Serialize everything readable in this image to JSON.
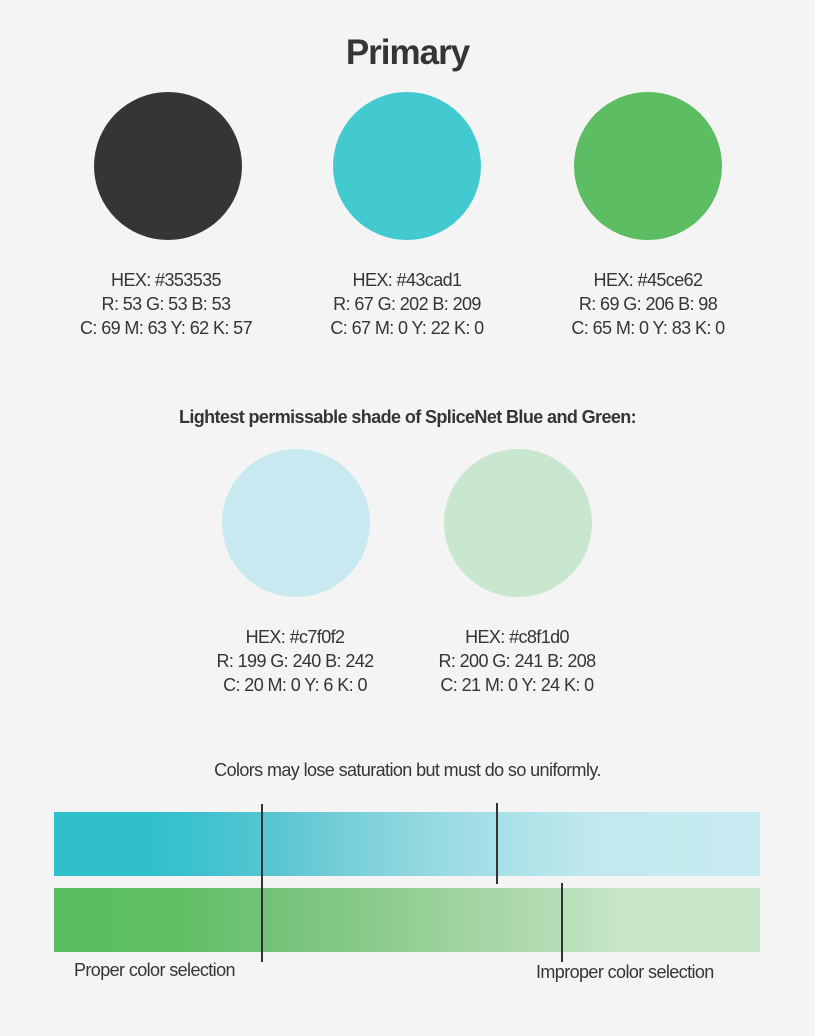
{
  "title": "Primary",
  "primary": [
    {
      "color": "#353535",
      "hex": "HEX: #353535",
      "rgb": "R: 53 G: 53 B: 53",
      "cmyk": "C: 69 M: 63 Y: 62 K: 57"
    },
    {
      "color": "#43cad1",
      "hex": "HEX: #43cad1",
      "rgb": "R: 67 G: 202 B: 209",
      "cmyk": "C: 67 M: 0 Y: 22 K: 0"
    },
    {
      "color": "#5cbd62",
      "hex": "HEX: #45ce62",
      "rgb": "R: 69 G: 206 B: 98",
      "cmyk": "C: 65 M: 0 Y: 83 K: 0"
    }
  ],
  "lightest_heading": "Lightest permissable shade of SpliceNet Blue and Green:",
  "lightest": [
    {
      "color": "#c9e9f0",
      "hex": "HEX: #c7f0f2",
      "rgb": "R: 199 G: 240 B: 242",
      "cmyk": "C: 20 M: 0 Y: 6 K: 0"
    },
    {
      "color": "#c9e6cf",
      "hex": "HEX: #c8f1d0",
      "rgb": "R: 200 G: 241 B: 208",
      "cmyk": "C: 21 M: 0 Y: 24 K: 0"
    }
  ],
  "saturation_note": "Colors may lose saturation but must do so uniformly.",
  "proper_label": "Proper color selection",
  "improper_label": "Improper color selection"
}
